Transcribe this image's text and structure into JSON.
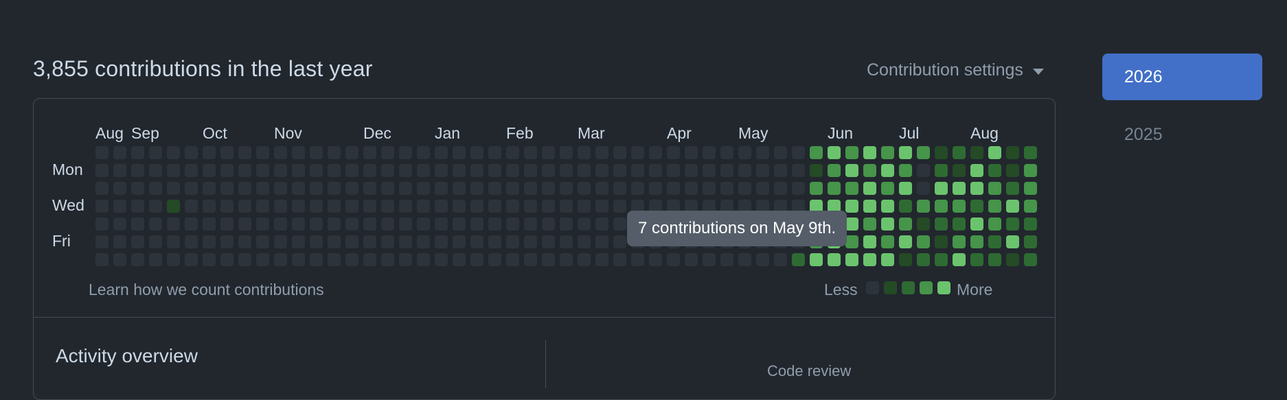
{
  "header": {
    "contributions_heading": "3,855 contributions in the last year",
    "settings_label": "Contribution settings"
  },
  "years": [
    "2026",
    "2025"
  ],
  "calendar": {
    "months": [
      "Aug",
      "Sep",
      "Oct",
      "Nov",
      "Dec",
      "Jan",
      "Feb",
      "Mar",
      "Apr",
      "May",
      "Jun",
      "Jul",
      "Aug"
    ],
    "day_labels": [
      "Mon",
      "Wed",
      "Fri"
    ],
    "weeks": 53,
    "levels": [
      "00000000000000000000000000000000000000003434343121412121211",
      "00000000000000000000000000000000000000001343430214213232312",
      "00000000000000000000000000000000000000003334340444323232212",
      "00001000000000000000000000000000000000004444423332343313313",
      "00000000000000000000000000000000000000004443431224322132312",
      "00000000000000000000000000000000000000003434343133242212313",
      "00000000000000000000000000000000000000024444412242212122102"
    ],
    "colors": {
      "level0": "#2d333b",
      "level1": "#244a26",
      "level2": "#2e6b32",
      "level3": "#46954a",
      "level4": "#6bc46d"
    },
    "learn_link": "Learn how we count contributions",
    "legend_less": "Less",
    "legend_more": "More"
  },
  "tooltip": "7 contributions on May 9th.",
  "activity": {
    "title": "Activity overview",
    "code_review_label": "Code review"
  }
}
